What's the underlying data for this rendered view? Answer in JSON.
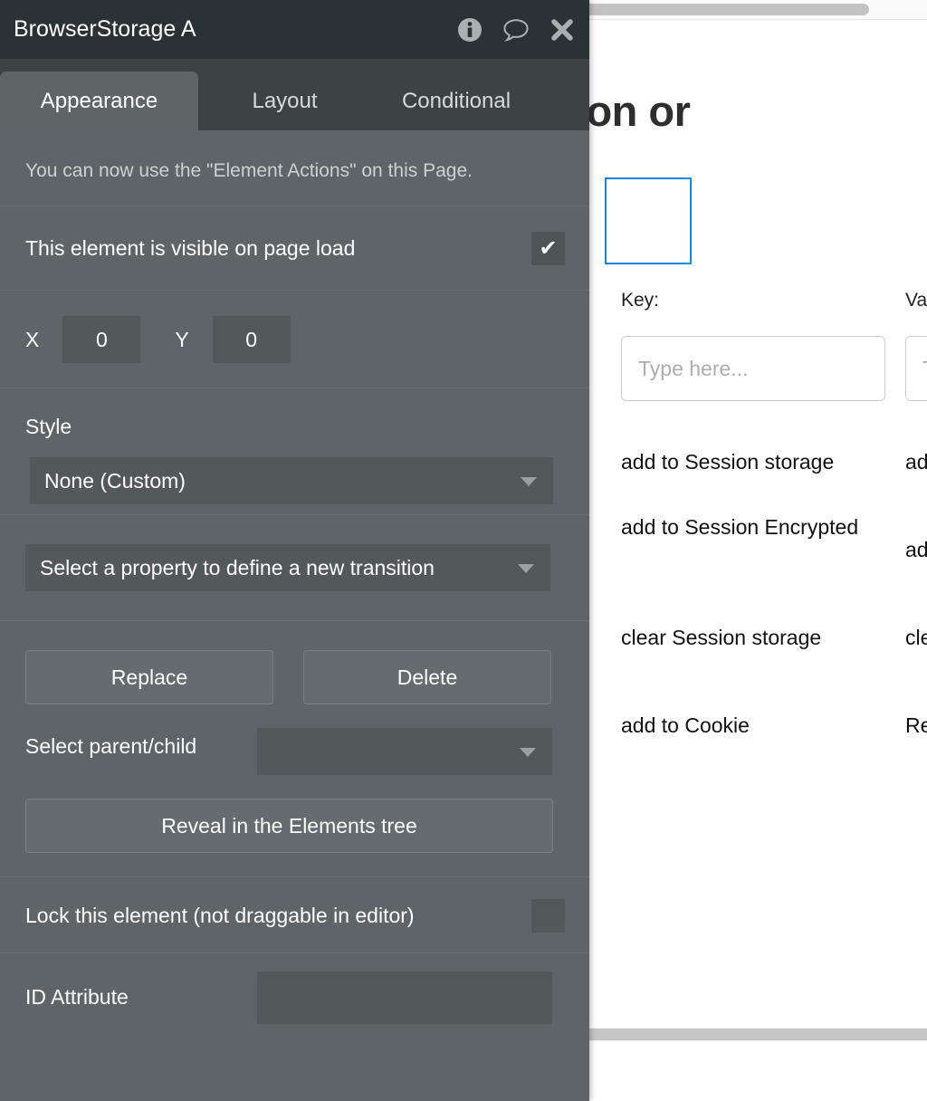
{
  "browser_page": {
    "heading": "Browser Session or",
    "heading_visible_fragment": "ser Session or",
    "columns": [
      {
        "label": "Key:",
        "placeholder": "Type here..."
      },
      {
        "label": "Value:",
        "label_visible_fragment": "Va",
        "placeholder": "Type here..."
      }
    ],
    "actions_left": [
      "add to Session storage",
      "add to Session Encrypted",
      "clear Session storage",
      "add to Cookie"
    ],
    "actions_right": [
      "add to Session storage",
      "add to Session Encrypted",
      "clear Session storage",
      "Read Cookie"
    ],
    "selection_outline_color": "#1787e0"
  },
  "editor": {
    "titlebar": {
      "title": "BrowserStorage A",
      "icons": [
        {
          "name": "info-icon",
          "glyph": "i"
        },
        {
          "name": "comment-icon",
          "glyph": "speech-bubble"
        },
        {
          "name": "close-icon",
          "glyph": "x"
        }
      ]
    },
    "tabs": [
      {
        "label": "Appearance",
        "active": true
      },
      {
        "label": "Layout",
        "active": false
      },
      {
        "label": "Conditional",
        "active": false
      }
    ],
    "hint": "You can now use the \"Element Actions\" on this Page.",
    "visible_on_load": {
      "label": "This element is visible on page load",
      "checked": true,
      "check_glyph": "✔"
    },
    "position": {
      "x_label": "X",
      "x_value": "0",
      "y_label": "Y",
      "y_value": "0"
    },
    "style": {
      "label": "Style",
      "selected": "None (Custom)"
    },
    "transition": {
      "selected": "Select a property to define a new transition"
    },
    "buttons": {
      "replace": "Replace",
      "delete": "Delete",
      "reveal": "Reveal in the Elements tree"
    },
    "parent_child": {
      "label": "Select parent/child",
      "selected": ""
    },
    "lock": {
      "label": "Lock this element (not draggable in editor)",
      "checked": false
    },
    "id_attribute": {
      "label": "ID Attribute",
      "value": ""
    },
    "colors": {
      "titlebar_bg": "#2b3235",
      "tabstrip_bg": "#3d4345",
      "panel_bg": "#5e6468",
      "field_bg": "#53585b",
      "active_tab_bg": "#5f6467"
    }
  }
}
